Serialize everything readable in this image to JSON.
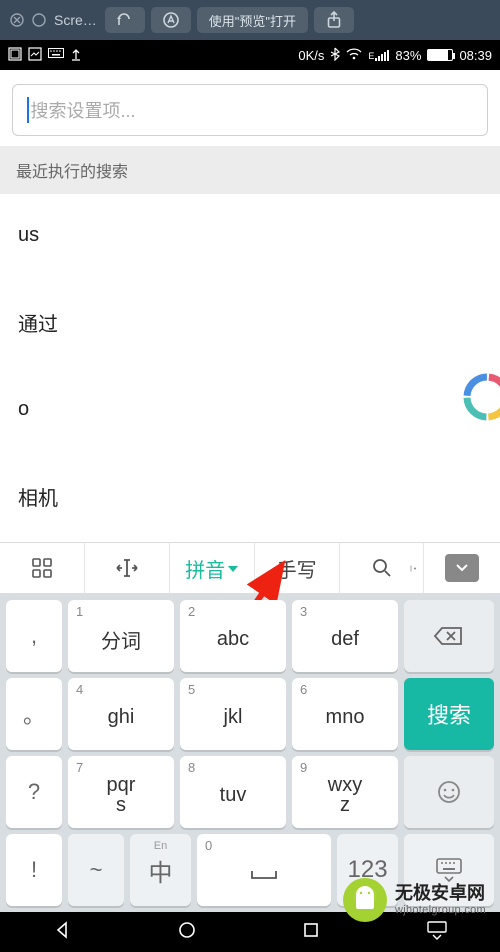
{
  "mac_toolbar": {
    "title": "Scre…",
    "open_with_label": "使用\"预览\"打开"
  },
  "status_bar": {
    "speed": "0K/s",
    "battery_pct": "83%",
    "time": "08:39"
  },
  "search": {
    "placeholder": "搜索设置项..."
  },
  "section_header": "最近执行的搜索",
  "recent": [
    "us",
    "通过",
    "o",
    "相机"
  ],
  "kb_toolbar": {
    "pinyin": "拼音",
    "handwrite": "手写"
  },
  "keys": {
    "r1": [
      {
        "side": ","
      },
      {
        "d": "1",
        "l": "分词"
      },
      {
        "d": "2",
        "l": "abc"
      },
      {
        "d": "3",
        "l": "def"
      }
    ],
    "r2": [
      {
        "side": "。"
      },
      {
        "d": "4",
        "l": "ghi"
      },
      {
        "d": "5",
        "l": "jkl"
      },
      {
        "d": "6",
        "l": "mno"
      },
      {
        "action": "搜索"
      }
    ],
    "r3": [
      {
        "side": "?"
      },
      {
        "d": "7",
        "l": "pqr\ns"
      },
      {
        "d": "8",
        "l": "tuv"
      },
      {
        "d": "9",
        "l": "wxy\nz"
      }
    ],
    "r4": [
      {
        "side": "!"
      },
      {
        "side2": "~"
      },
      {
        "sub": "En",
        "l": "中"
      },
      {
        "d": "0",
        "l": "␣"
      },
      {
        "sub": "",
        "l": "123"
      }
    ]
  },
  "watermark": {
    "title": "无极安卓网",
    "url": "wjhotelgroup.com"
  }
}
